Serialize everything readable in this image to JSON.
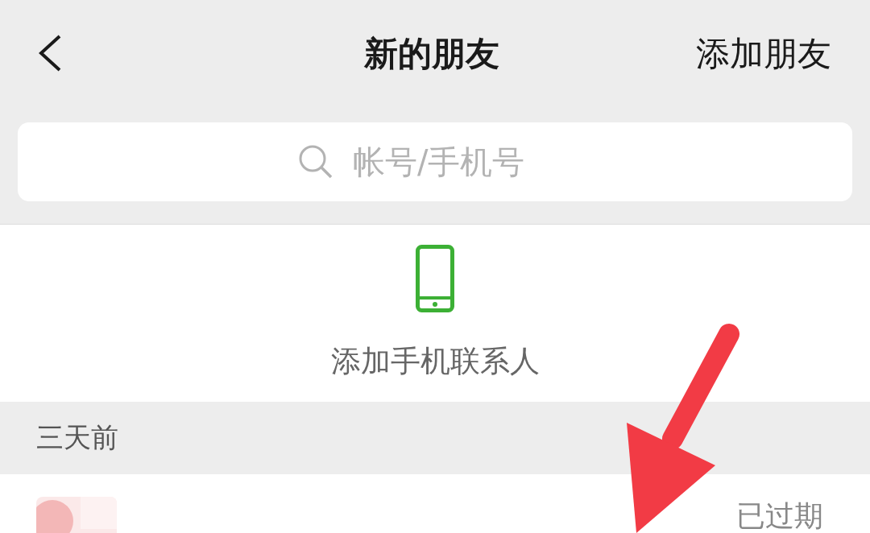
{
  "header": {
    "title": "新的朋友",
    "action": "添加朋友"
  },
  "search": {
    "placeholder": "帐号/手机号"
  },
  "add_contacts": {
    "label": "添加手机联系人"
  },
  "section": {
    "title": "三天前"
  },
  "requests": [
    {
      "status": "已过期"
    }
  ]
}
